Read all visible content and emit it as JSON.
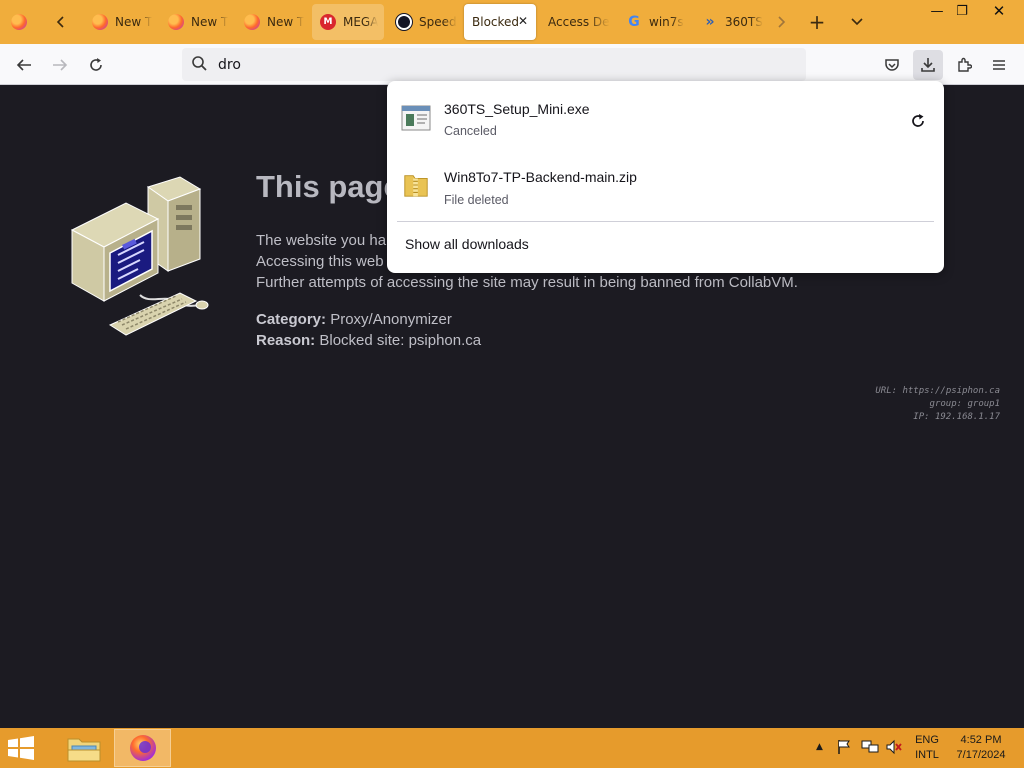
{
  "browser": {
    "tabs": [
      {
        "label": "New T",
        "favicon": "firefox-icon"
      },
      {
        "label": "New T",
        "favicon": "firefox-icon"
      },
      {
        "label": "New T",
        "favicon": "firefox-icon"
      },
      {
        "label": "MEGA",
        "favicon": "mega-icon"
      },
      {
        "label": "Speed",
        "favicon": "speedtest-icon"
      },
      {
        "label": "Blocked",
        "favicon": "none",
        "active": true
      },
      {
        "label": "Access De",
        "favicon": "none"
      },
      {
        "label": "win7s",
        "favicon": "google-icon"
      },
      {
        "label": "360TS",
        "favicon": "chevron-icon"
      }
    ],
    "url_text": "dro",
    "accent_color": "#f0ad3c"
  },
  "page": {
    "heading": "This page",
    "message_lines": [
      "The website you ha",
      "Accessing this web",
      "Further attempts of accessing the site may result in being banned from CollabVM."
    ],
    "category_label": "Category:",
    "category_value": "Proxy/Anonymizer",
    "reason_label": "Reason:",
    "reason_value": "Blocked site: psiphon.ca",
    "meta": {
      "url": "URL: https://psiphon.ca",
      "group": "group: group1",
      "ip": "IP: 192.168.1.17"
    }
  },
  "downloads": {
    "items": [
      {
        "name": "360TS_Setup_Mini.exe",
        "status": "Canceled",
        "icon": "installer-icon"
      },
      {
        "name": "Win8To7-TP-Backend-main.zip",
        "status": "File deleted",
        "icon": "zip-folder-icon"
      }
    ],
    "show_all_label": "Show all downloads"
  },
  "taskbar": {
    "lang_line1": "ENG",
    "lang_line2": "INTL",
    "time": "4:52 PM",
    "date": "7/17/2024",
    "color": "#e69b2c"
  }
}
